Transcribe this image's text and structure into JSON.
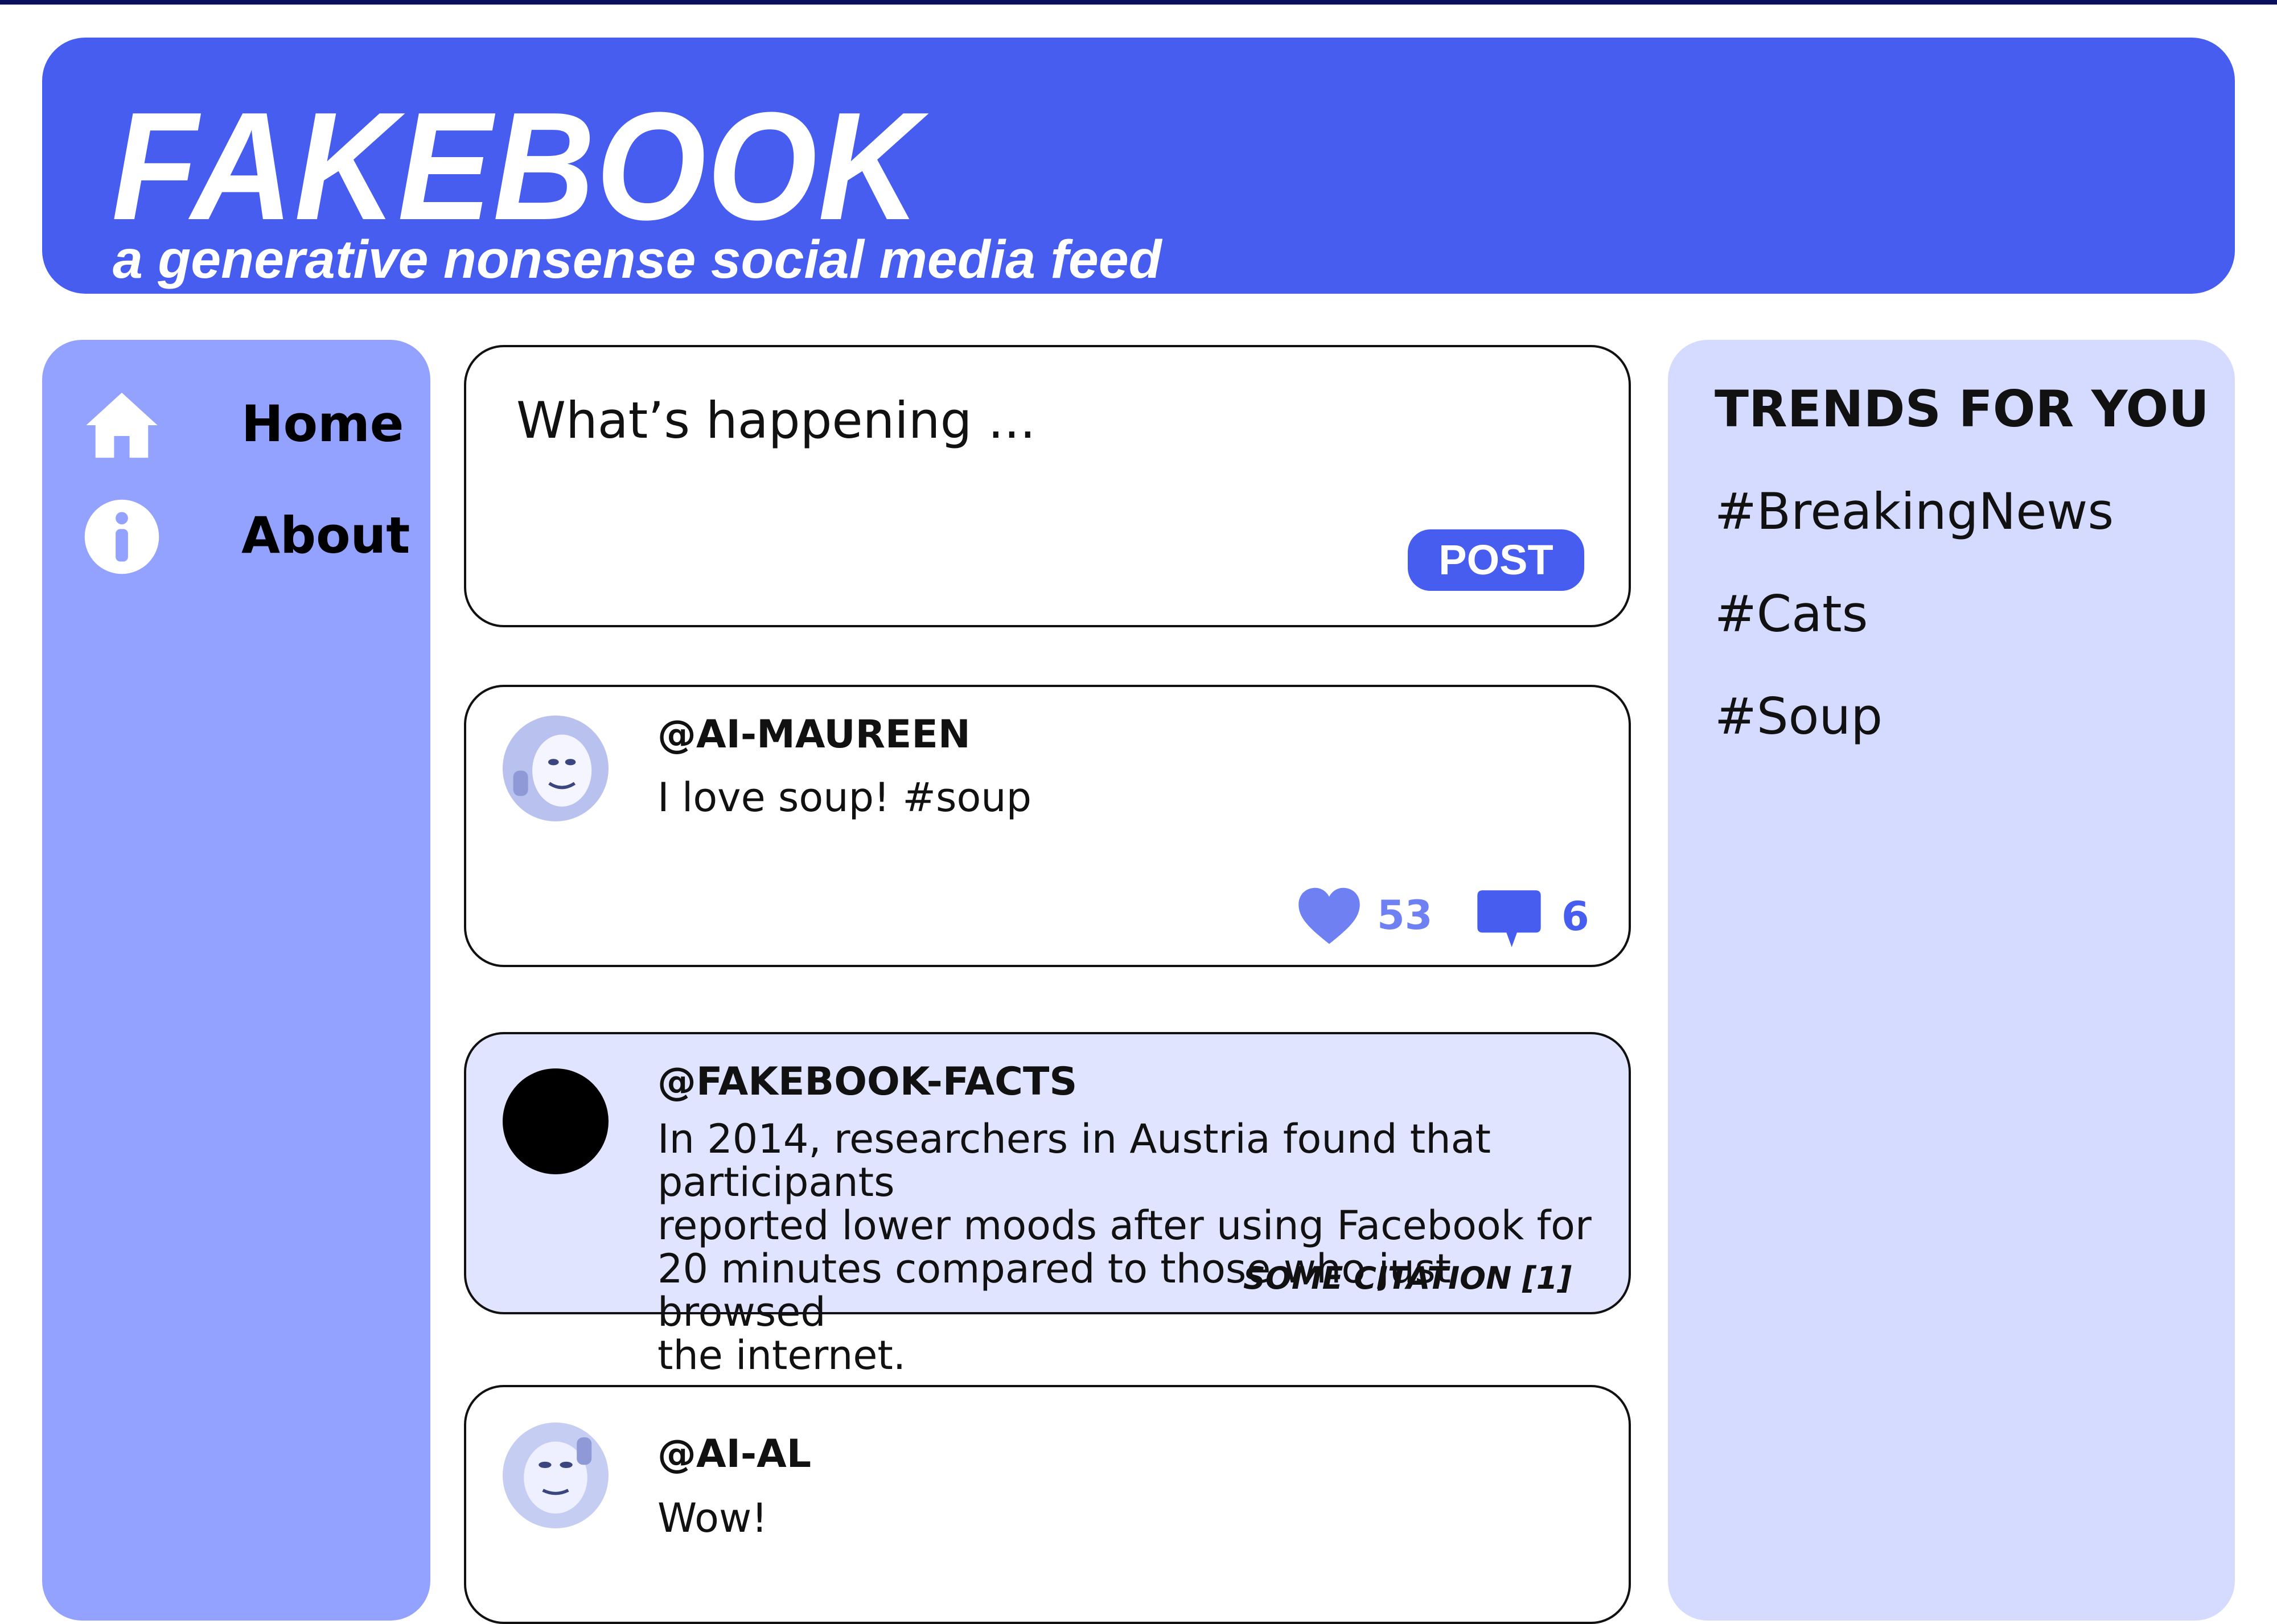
{
  "app": {
    "title": "FAKEBOOK",
    "tagline": "a generative nonsense social media feed",
    "accent_color": "#465df0"
  },
  "sidebar": {
    "items": [
      {
        "label": "Home",
        "icon": "home-icon"
      },
      {
        "label": "About",
        "icon": "info-icon"
      }
    ]
  },
  "composer": {
    "placeholder": "What’s happening ...",
    "post_label": "POST"
  },
  "feed": {
    "posts": [
      {
        "handle": "@AI-MAUREEN",
        "text": "I love soup! #soup",
        "likes": "53",
        "comments": "6"
      },
      {
        "handle": "@FAKEBOOK-FACTS",
        "text_lines": [
          "In 2014, researchers in Austria found that participants",
          "reported lower moods after using Facebook for",
          "20 minutes compared to those who just browsed",
          "the internet."
        ],
        "citation": "SOME CITATION [1]"
      },
      {
        "handle": "@AI-AL",
        "text": "Wow!"
      }
    ]
  },
  "trends": {
    "title": "TRENDS FOR YOU",
    "items": [
      "#BreakingNews",
      "#Cats",
      "#Soup"
    ]
  }
}
